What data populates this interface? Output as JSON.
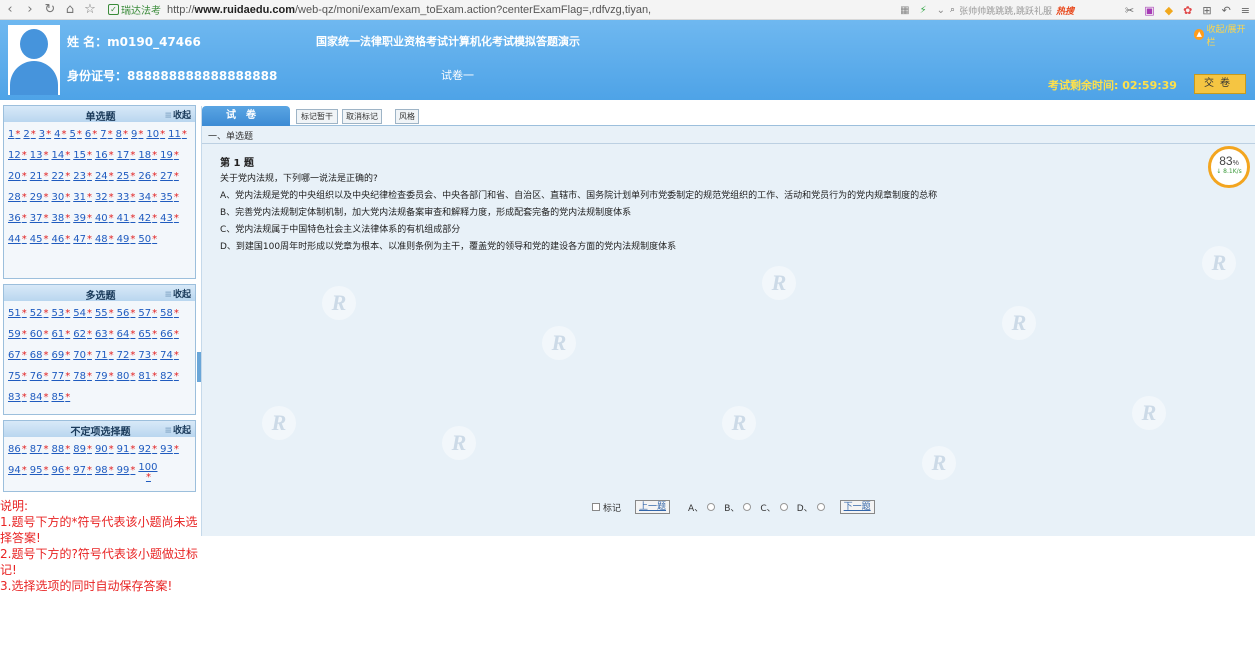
{
  "browser": {
    "site_label": "瑞达法考",
    "url_prefix": "http://",
    "url_domain": "www.ruidaedu.com",
    "url_path": "/web-qz/moni/exam/exam_toExam.action?centerExamFlag=,rdfvzg,tiyan,",
    "search_placeholder": "张帅帅跳跳跳,跳跃礼服",
    "search_hot": "热搜"
  },
  "header": {
    "name_line": "姓 名：m0190_47466",
    "id_line": "身份证号：888888888888888888",
    "exam_title": "国家统一法律职业资格考试计算机化考试模拟答题演示",
    "paper_name": "试卷一",
    "favorite_label": "收起/展开栏",
    "timer": "考试剩余时间: 02:59:39",
    "submit_label": "交卷"
  },
  "left": {
    "collapse_label": "收起",
    "sections": [
      {
        "title": "单选题",
        "items": [
          "1",
          "2",
          "3",
          "4",
          "5",
          "6",
          "7",
          "8",
          "9",
          "10",
          "11",
          "12",
          "13",
          "14",
          "15",
          "16",
          "17",
          "18",
          "19",
          "20",
          "21",
          "22",
          "23",
          "24",
          "25",
          "26",
          "27",
          "28",
          "29",
          "30",
          "31",
          "32",
          "33",
          "34",
          "35",
          "36",
          "37",
          "38",
          "39",
          "40",
          "41",
          "42",
          "43",
          "44",
          "45",
          "46",
          "47",
          "48",
          "49",
          "50"
        ]
      },
      {
        "title": "多选题",
        "items": [
          "51",
          "52",
          "53",
          "54",
          "55",
          "56",
          "57",
          "58",
          "59",
          "60",
          "61",
          "62",
          "63",
          "64",
          "65",
          "66",
          "67",
          "68",
          "69",
          "70",
          "71",
          "72",
          "73",
          "74",
          "75",
          "76",
          "77",
          "78",
          "79",
          "80",
          "81",
          "82",
          "83",
          "84",
          "85"
        ]
      },
      {
        "title": "不定项选择题",
        "items": [
          "86",
          "87",
          "88",
          "89",
          "90",
          "91",
          "92",
          "93",
          "94",
          "95",
          "96",
          "97",
          "98",
          "99",
          "100"
        ]
      }
    ],
    "star": "*",
    "notes": [
      "说明:",
      "1.题号下方的*符号代表该小题尚未选择答案!",
      "2.题号下方的?符号代表该小题做过标记!",
      "3.选择选项的同时自动保存答案!"
    ]
  },
  "main": {
    "tab_label": "试卷",
    "buttons": [
      "标记暂干",
      "取消标记",
      "风格"
    ],
    "section_label": "一、单选题",
    "question_number": "第 1 题",
    "question_text": "关于党内法规，下列哪一说法是正确的?",
    "options": [
      "A、党内法规是党的中央组织以及中央纪律检查委员会、中央各部门和省、自治区、直辖市、国务院计划单列市党委制定的规范党组织的工作、活动和党员行为的党内规章制度的总称",
      "B、完善党内法规制定体制机制，加大党内法规备案审查和解释力度，形成配套完备的党内法规制度体系",
      "C、党内法规属于中国特色社会主义法律体系的有机组成部分",
      "D、到建国100周年时形成以党章为根本、以准则条例为主干，覆盖党的领导和党的建设各方面的党内法规制度体系"
    ],
    "gauge_percent": "83",
    "gauge_percent_unit": "%",
    "gauge_speed": "↓ 8.1K/s"
  },
  "answer_bar": {
    "mark_label": "标记",
    "prev_label": "上一题",
    "choices": [
      "A、",
      "B、",
      "C、",
      "D、"
    ],
    "next_label": "下一题"
  }
}
